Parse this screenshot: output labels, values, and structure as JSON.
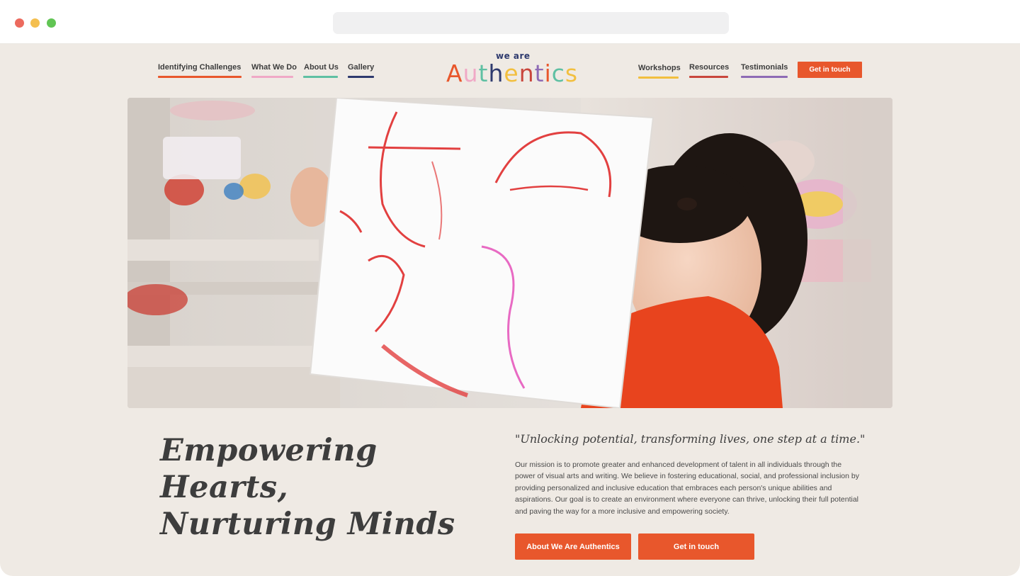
{
  "nav": {
    "left_links": [
      {
        "label": "Identifying Challenges",
        "underline_color": "#e8572c"
      },
      {
        "label": "What We Do",
        "underline_color": "#f0a9c6"
      },
      {
        "label": "About Us",
        "underline_color": "#5fc0a3"
      },
      {
        "label": "Gallery",
        "underline_color": "#2e3a6e"
      }
    ],
    "right_links": [
      {
        "label": "Workshops",
        "underline_color": "#f2bf3f"
      },
      {
        "label": "Resources",
        "underline_color": "#c9463c"
      },
      {
        "label": "Testimonials",
        "underline_color": "#8e6bb5"
      }
    ],
    "cta_label": "Get in touch"
  },
  "logo": {
    "top_text": "we are",
    "letters": [
      {
        "ch": "A",
        "color": "#e8572c"
      },
      {
        "ch": "u",
        "color": "#f0a9c6"
      },
      {
        "ch": "t",
        "color": "#5fc0a3"
      },
      {
        "ch": "h",
        "color": "#2e3a6e"
      },
      {
        "ch": "e",
        "color": "#f2bf3f"
      },
      {
        "ch": "n",
        "color": "#c9463c"
      },
      {
        "ch": "t",
        "color": "#8e6bb5"
      },
      {
        "ch": "i",
        "color": "#e8572c"
      },
      {
        "ch": "c",
        "color": "#5fc0a3"
      },
      {
        "ch": "s",
        "color": "#f2bf3f"
      }
    ]
  },
  "hero": {
    "image_icon": "photo-child-holding-drawing"
  },
  "content": {
    "headline_line1": "Empowering Hearts,",
    "headline_line2": "Nurturing Minds",
    "quote": "\"Unlocking potential, transforming lives, one step at a time.\"",
    "mission": "Our mission is to promote greater and enhanced development of talent in all individuals through the power of visual arts and writing. We believe in fostering educational, social, and professional inclusion by providing personalized and inclusive education that embraces each person's unique abilities and aspirations. Our goal is to create an environment where everyone can thrive, unlocking their full potential and paving the way for a more inclusive and empowering society.",
    "button_about": "About We Are Authentics",
    "button_contact": "Get in touch"
  },
  "colors": {
    "accent": "#e8572c",
    "page_bg": "#efeae4",
    "text": "#3d3d3d"
  }
}
